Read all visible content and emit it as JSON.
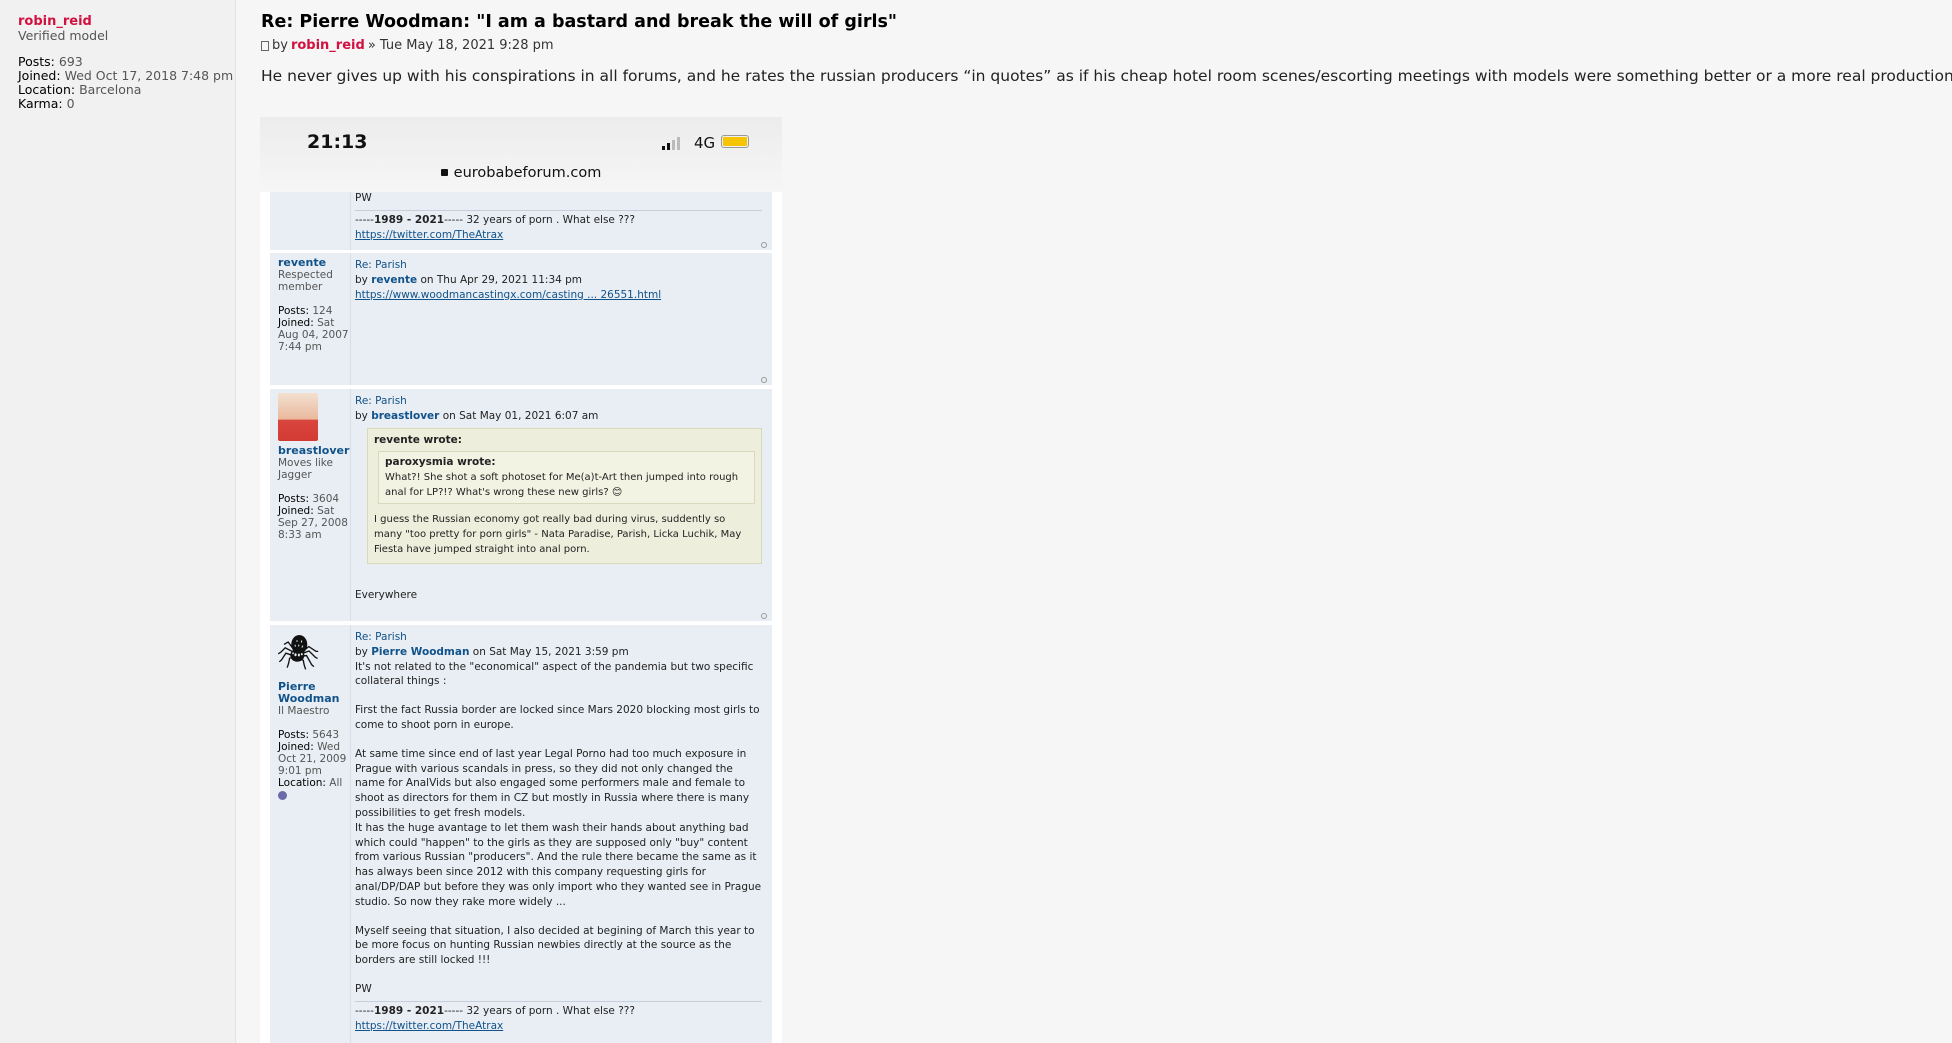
{
  "profile": {
    "username": "robin_reid",
    "rank": "Verified model",
    "posts_label": "Posts:",
    "posts": "693",
    "joined_label": "Joined:",
    "joined": "Wed Oct 17, 2018 7:48 pm",
    "location_label": "Location:",
    "location": "Barcelona",
    "karma_label": "Karma:",
    "karma": "0"
  },
  "post": {
    "title": "Re: Pierre Woodman: \"I am a bastard and break the will of girls\"",
    "by": "by",
    "author": "robin_reid",
    "date": "» Tue May 18, 2021 9:28 pm",
    "content": "He never gives up with his conspirations in all forums, and he rates the russian producers “in quotes” as if his cheap hotel room scenes/escorting meetings with models were something better or a more real production..."
  },
  "phone": {
    "time": "21:13",
    "network": "4G",
    "url": "eurobabeforum.com"
  },
  "forum": {
    "top": {
      "pw": "PW",
      "sig_pre": "-----",
      "sig_years": "1989 - 2021",
      "sig_post": "----- 32 years of porn . What else ???",
      "sig_link": "https://twitter.com/TheAtrax"
    },
    "p1": {
      "name": "revente",
      "rank": "Respected member",
      "posts_label": "Posts:",
      "posts": "124",
      "joined_label": "Joined:",
      "joined": "Sat Aug 04, 2007 7:44 pm",
      "title": "Re: Parish",
      "by": "by",
      "author": "revente",
      "date": "on Thu Apr 29, 2021 11:34 pm",
      "link": "https://www.woodmancastingx.com/casting ... 26551.html"
    },
    "p2": {
      "name": "breastlover",
      "rank": "Moves like Jagger",
      "posts_label": "Posts:",
      "posts": "3604",
      "joined_label": "Joined:",
      "joined": "Sat Sep 27, 2008 8:33 am",
      "title": "Re: Parish",
      "by": "by",
      "author": "breastlover",
      "date": "on Sat May 01, 2021 6:07 am",
      "quote_cite": "revente wrote:",
      "inner_cite": "paroxysmia wrote:",
      "inner_text": "What?! She shot a soft photoset for Me(a)t-Art then jumped into rough anal for LP?!? What's wrong these new girls? ",
      "quote_text": "I guess the Russian economy got really bad during virus, suddently so many \"too pretty for porn girls\" - Nata Paradise, Parish, Licka Luchik, May Fiesta have jumped straight into anal porn.",
      "reply": "Everywhere"
    },
    "p3": {
      "name": "Pierre Woodman",
      "rank": "Il Maestro",
      "posts_label": "Posts:",
      "posts": "5643",
      "joined_label": "Joined:",
      "joined": "Wed Oct 21, 2009 9:01 pm",
      "location_label": "Location:",
      "location": "All",
      "title": "Re: Parish",
      "by": "by",
      "author": "Pierre Woodman",
      "date": "on Sat May 15, 2021 3:59 pm",
      "para1": "It's not related to the \"economical\" aspect of the pandemia but two specific collateral things :",
      "para2": "First the fact Russia border are locked since Mars 2020 blocking most girls to come to shoot porn in europe.",
      "para3": "At same time since end of last year Legal Porno had too much exposure in Prague with various scandals in press, so they did not only changed the name for AnalVids but also engaged some performers male and female to shoot as directors for them in CZ but mostly in Russia where there is many possibilities to get fresh models.",
      "para4": "It has the huge avantage to let them wash their hands about anything bad which could \"happen\" to the girls as they are supposed only \"buy\" content from various Russian \"producers\". And the rule there became the same as it has always been since 2012 with this company requesting girls for anal/DP/DAP but before they was only import who they wanted see in Prague studio. So now they rake more widely ...",
      "para5": "Myself seeing that situation, I also decided at begining of March this year to be more focus on hunting Russian newbies directly at the source as the borders are still locked !!!",
      "pw": "PW",
      "sig_pre": "-----",
      "sig_years": "1989 - 2021",
      "sig_post": "----- 32 years of porn . What else ???",
      "sig_link": "https://twitter.com/TheAtrax"
    }
  }
}
